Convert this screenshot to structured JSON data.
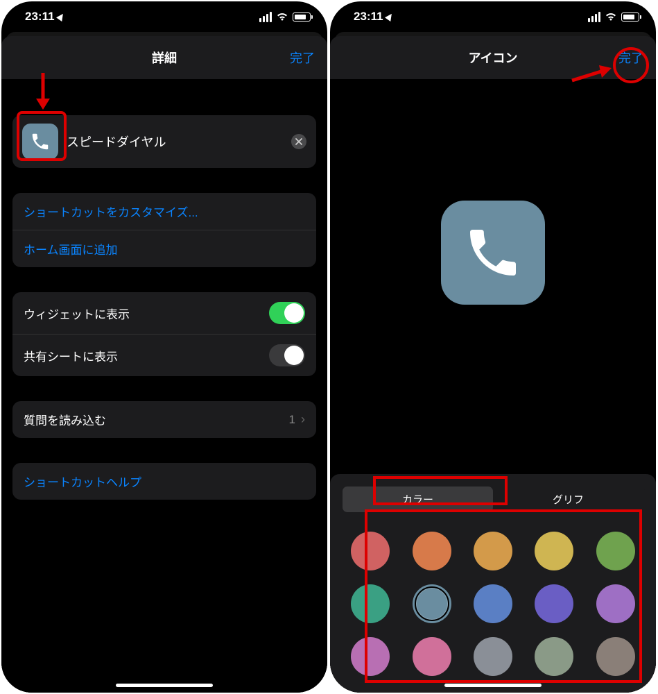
{
  "status": {
    "time": "23:11"
  },
  "left": {
    "nav": {
      "title": "詳細",
      "done": "完了"
    },
    "name_field": {
      "value": "スピードダイヤル"
    },
    "actions": {
      "customize": "ショートカットをカスタマイズ...",
      "add_home": "ホーム画面に追加"
    },
    "toggles": {
      "widget": "ウィジェットに表示",
      "share": "共有シートに表示"
    },
    "import_q": {
      "label": "質問を読み込む",
      "value": "1"
    },
    "help": "ショートカットヘルプ"
  },
  "right": {
    "nav": {
      "title": "アイコン",
      "done": "完了"
    },
    "segments": {
      "color": "カラー",
      "glyph": "グリフ"
    },
    "colors": [
      {
        "hex": "#d06262"
      },
      {
        "hex": "#d77a4a"
      },
      {
        "hex": "#d39a4a"
      },
      {
        "hex": "#cfb552"
      },
      {
        "hex": "#6fa24e"
      },
      {
        "hex": "#3aa083"
      },
      {
        "hex": "#6a8da0",
        "selected": true
      },
      {
        "hex": "#5a7fc4"
      },
      {
        "hex": "#6a5ec4"
      },
      {
        "hex": "#9e6fc4"
      },
      {
        "hex": "#b86fb3"
      },
      {
        "hex": "#d0709a"
      },
      {
        "hex": "#8a8f97"
      },
      {
        "hex": "#8a9a87"
      },
      {
        "hex": "#8a7f78"
      }
    ]
  }
}
